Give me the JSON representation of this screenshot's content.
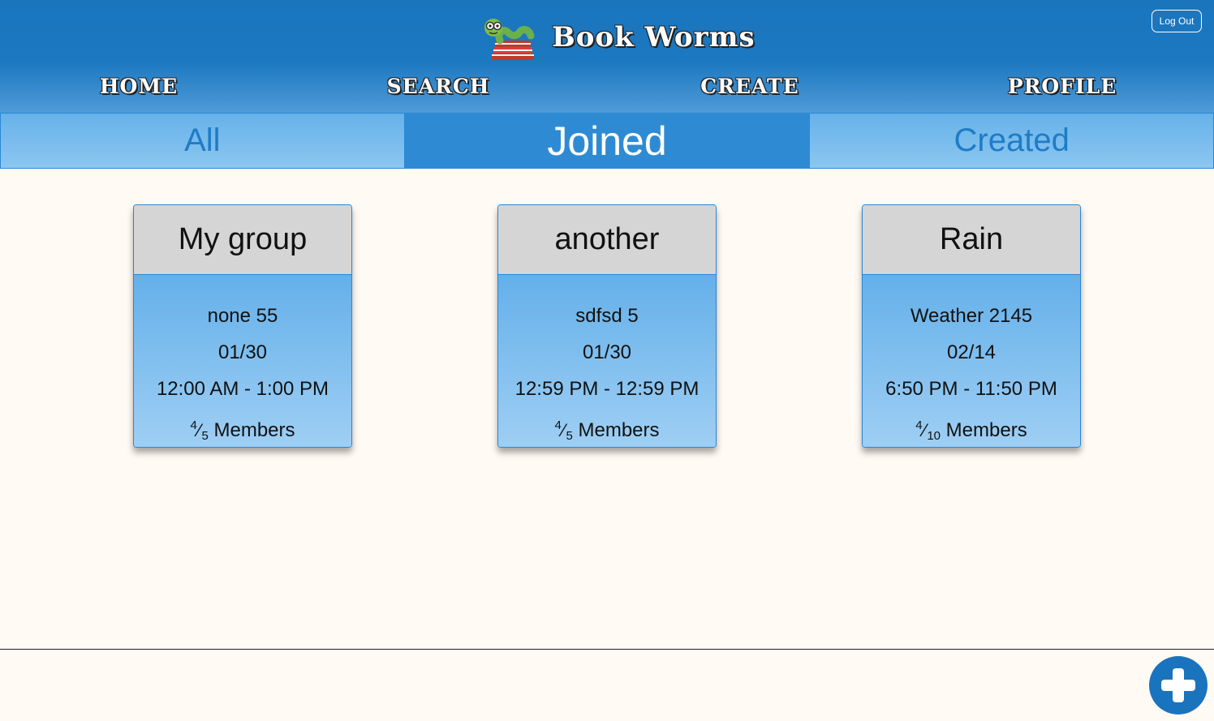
{
  "app": {
    "name": "Book Worms",
    "logout_label": "Log Out",
    "logo_icon": "bookworm-on-books-icon"
  },
  "nav": [
    {
      "label": "Home"
    },
    {
      "label": "Search"
    },
    {
      "label": "Create"
    },
    {
      "label": "Profile"
    }
  ],
  "tabs": [
    {
      "label": "All",
      "active": false
    },
    {
      "label": "Joined",
      "active": true
    },
    {
      "label": "Created",
      "active": false
    }
  ],
  "groups": [
    {
      "name": "My group",
      "book": "none 55",
      "date": "01/30",
      "time": "12:00 AM - 1:00 PM",
      "members_current": "4",
      "members_max": "5",
      "members_label": "Members"
    },
    {
      "name": "another",
      "book": "sdfsd 5",
      "date": "01/30",
      "time": "12:59 PM - 12:59 PM",
      "members_current": "4",
      "members_max": "5",
      "members_label": "Members"
    },
    {
      "name": "Rain",
      "book": "Weather 2145",
      "date": "02/14",
      "time": "6:50 PM - 11:50 PM",
      "members_current": "4",
      "members_max": "10",
      "members_label": "Members"
    }
  ],
  "fab": {
    "icon": "plus-icon"
  },
  "colors": {
    "header": "#1a75bd",
    "tab_active": "#2e8bd3",
    "card_head": "#d5d5d5",
    "background": "#fffaf3"
  }
}
